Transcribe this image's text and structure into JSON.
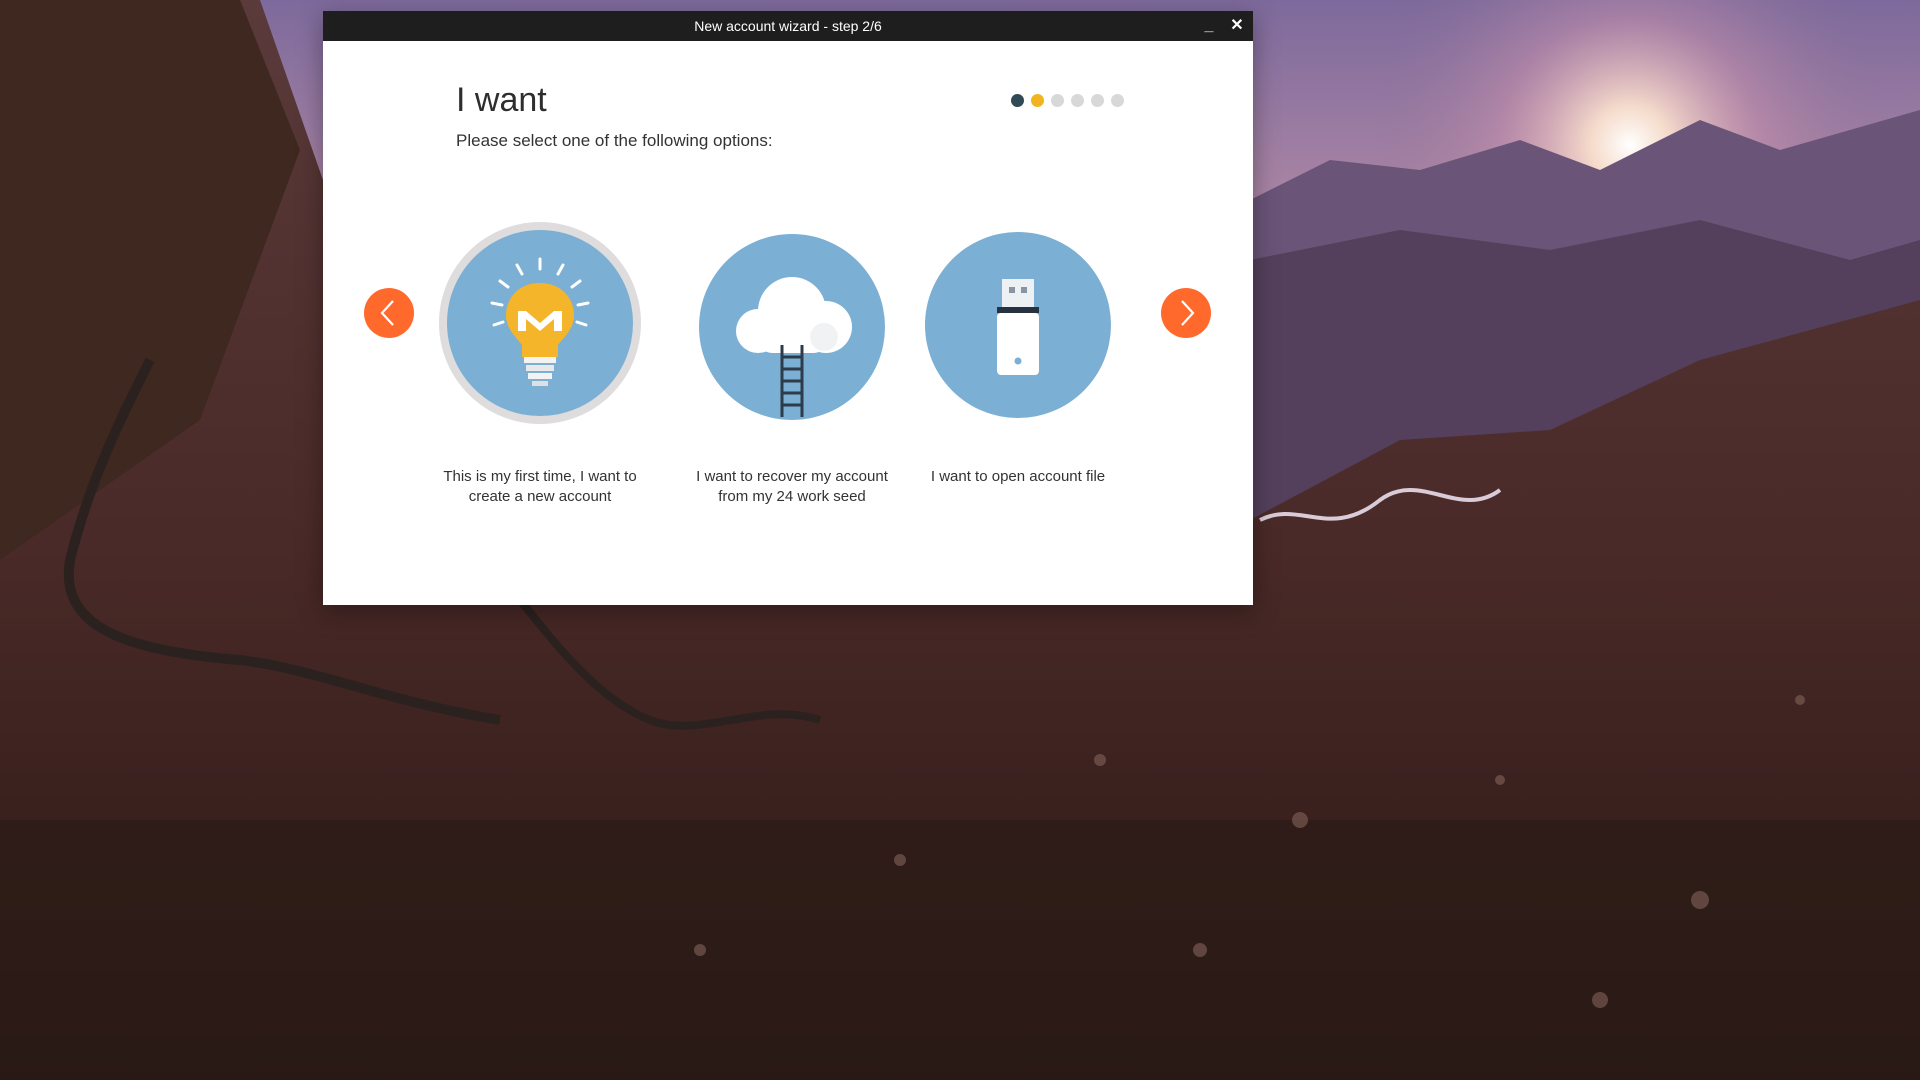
{
  "window": {
    "title": "New account wizard - step 2/6",
    "minimize_label": "_",
    "close_label": "✕"
  },
  "page": {
    "heading": "I want",
    "subheading": "Please select one of the following options:"
  },
  "progress": {
    "total_steps": 6,
    "current_step": 2
  },
  "options": [
    {
      "label_line1": "This is my first time, I want to",
      "label_line2": "create a new account",
      "icon": "lightbulb-monero-icon",
      "selected": true
    },
    {
      "label_line1": "I want to recover my account",
      "label_line2": "from my 24 work seed",
      "icon": "cloud-ladder-icon",
      "selected": false
    },
    {
      "label_line1": "I want to open account file",
      "label_line2": "",
      "icon": "usb-drive-icon",
      "selected": false
    }
  ],
  "navigation": {
    "prev_icon": "chevron-left-icon",
    "next_icon": "chevron-right-icon"
  },
  "colors": {
    "accent_orange": "#ff6a2c",
    "circle_blue": "#7bafd4",
    "dot_done": "#2f4a55",
    "dot_active": "#f0b41e",
    "dot_inactive": "#d8d8d8",
    "titlebar": "#1e1e1e"
  }
}
